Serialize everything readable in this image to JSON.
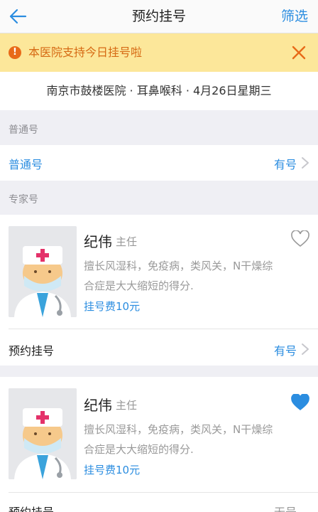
{
  "header": {
    "title": "预约挂号",
    "filter_label": "筛选"
  },
  "notice": {
    "text": "本医院支持今日挂号啦"
  },
  "info": {
    "line": "南京市鼓楼医院 · 耳鼻喉科 · 4月26日星期三"
  },
  "general": {
    "section_title": "普通号",
    "row_label": "普通号",
    "status": "有号"
  },
  "expert": {
    "section_title": "专家号"
  },
  "doctors": [
    {
      "name": "纪伟",
      "title": "主任",
      "desc_line1": "擅长风湿科，免疫病，类风关，N干燥综",
      "desc_line2": "合症是大大缩短的得分.",
      "fee": "挂号费10元",
      "favorited": false,
      "book_label": "预约挂号",
      "status": "有号"
    },
    {
      "name": "纪伟",
      "title": "主任",
      "desc_line1": "擅长风湿科，免疫病，类风关，N干燥综",
      "desc_line2": "合症是大大缩短的得分.",
      "fee": "挂号费10元",
      "favorited": true,
      "book_label": "预约挂号",
      "status": "无号"
    }
  ],
  "colors": {
    "accent": "#2b8de0",
    "notice_bg": "#fce79a",
    "notice_text": "#d66a14",
    "warn": "#e86a18"
  }
}
